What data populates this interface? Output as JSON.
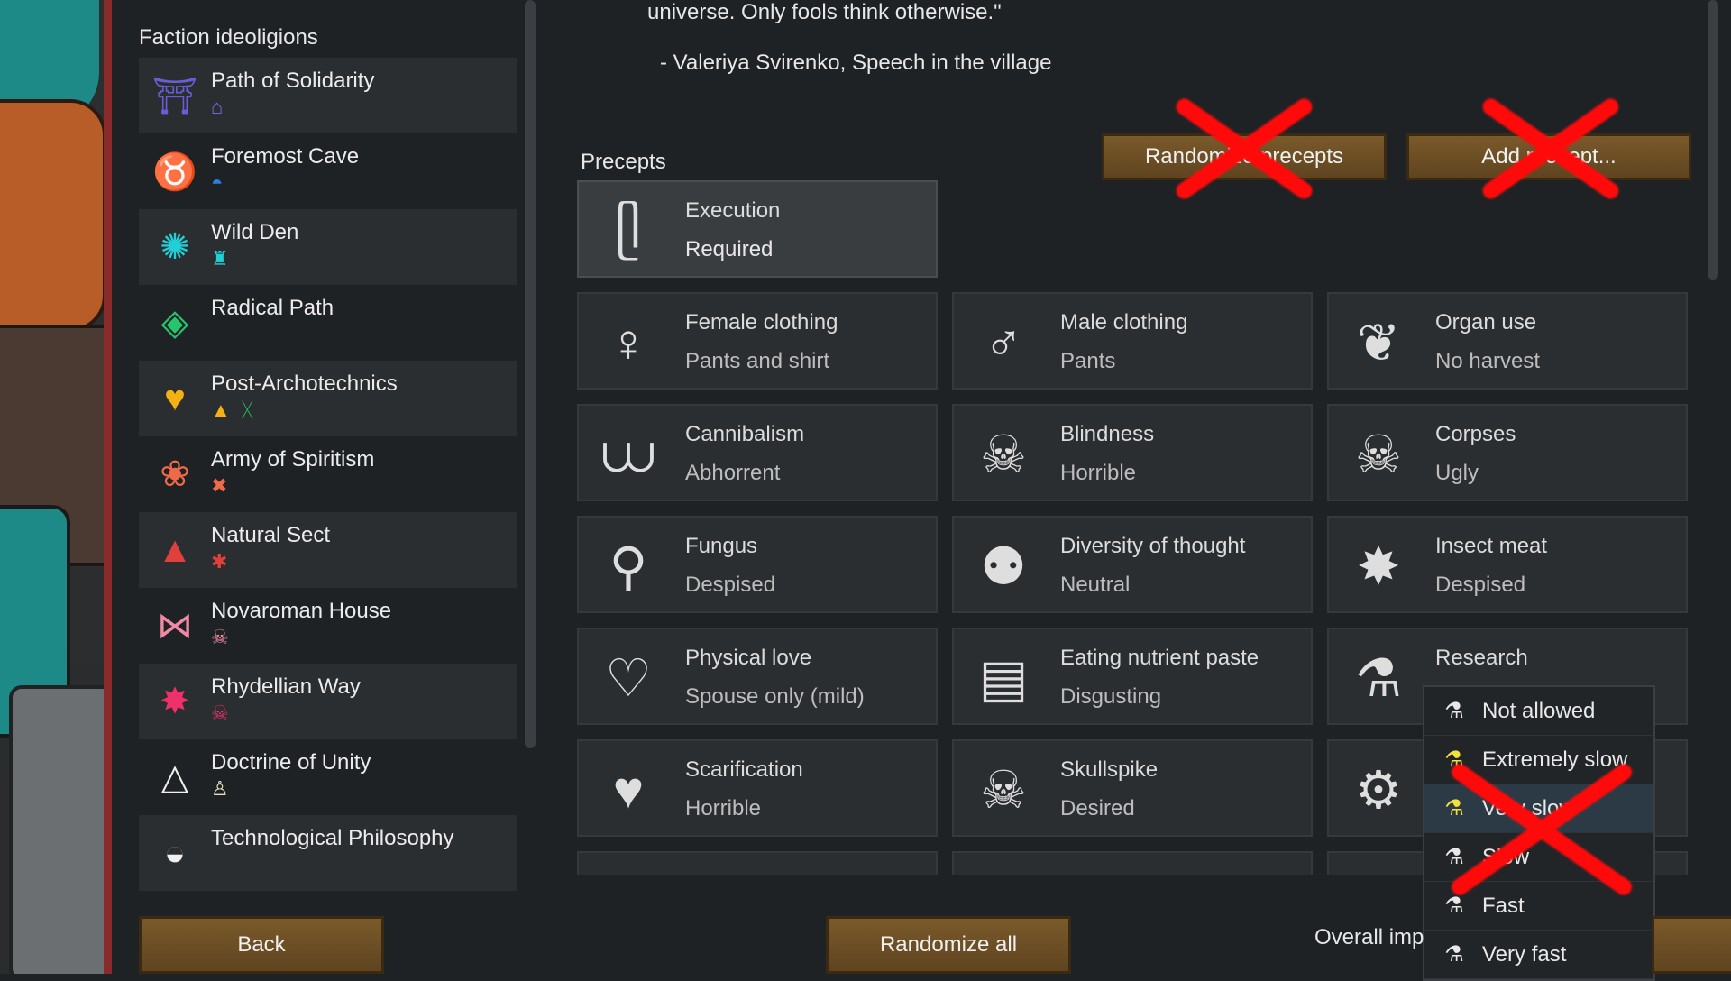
{
  "sidebar": {
    "title": "Faction ideoligions",
    "items": [
      {
        "name": "Path of Solidarity",
        "icon": "torii-icon",
        "icon_char": "⛩",
        "icon_color": "#6a5ed8",
        "minis": [
          {
            "name": "house-icon",
            "char": "⌂",
            "color": "#7b6cf0"
          }
        ]
      },
      {
        "name": "Foremost Cave",
        "icon": "horned-icon",
        "icon_char": "♉",
        "icon_color": "#2a7fe0",
        "minis": [
          {
            "name": "dome-icon",
            "char": "◓",
            "color": "#2a7fe0"
          }
        ]
      },
      {
        "name": "Wild Den",
        "icon": "spiral-icon",
        "icon_char": "✺",
        "icon_color": "#20d0d6",
        "minis": [
          {
            "name": "tower-icon",
            "char": "♜",
            "color": "#20d0d6"
          }
        ]
      },
      {
        "name": "Radical Path",
        "icon": "diamond-icon",
        "icon_char": "◈",
        "icon_color": "#26c46d",
        "minis": []
      },
      {
        "name": "Post-Archotechnics",
        "icon": "heart-split-icon",
        "icon_char": "♥",
        "icon_color": "#f5b014",
        "minis": [
          {
            "name": "warning-icon",
            "char": "▲",
            "color": "#f5b014"
          },
          {
            "name": "tongs-icon",
            "char": "ᚷ",
            "color": "#26c46d"
          }
        ]
      },
      {
        "name": "Army of Spiritism",
        "icon": "lotus-icon",
        "icon_char": "❀",
        "icon_color": "#f06a4a",
        "minis": [
          {
            "name": "crossed-icon",
            "char": "✖",
            "color": "#f06a4a"
          }
        ]
      },
      {
        "name": "Natural Sect",
        "icon": "triangle-icon",
        "icon_char": "▲",
        "icon_color": "#e0403c",
        "minis": [
          {
            "name": "bug-icon",
            "char": "✱",
            "color": "#e0403c"
          }
        ]
      },
      {
        "name": "Novaroman House",
        "icon": "bow-icon",
        "icon_char": "⋈",
        "icon_color": "#f08aa4",
        "minis": [
          {
            "name": "skull-mini-icon",
            "char": "☠",
            "color": "#f08aa4"
          }
        ]
      },
      {
        "name": "Rhydellian Way",
        "icon": "star-burst-icon",
        "icon_char": "✸",
        "icon_color": "#f0306a",
        "minis": [
          {
            "name": "skull-mini-icon",
            "char": "☠",
            "color": "#f0306a"
          }
        ]
      },
      {
        "name": "Doctrine of Unity",
        "icon": "pyramid-icon",
        "icon_char": "△",
        "icon_color": "#f0f0f0",
        "minis": [
          {
            "name": "pillar-icon",
            "char": "♙",
            "color": "#e8e0c0"
          }
        ]
      },
      {
        "name": "Technological Philosophy",
        "icon": "helmet-icon",
        "icon_char": "◒",
        "icon_color": "#f0f0f0",
        "minis": []
      }
    ]
  },
  "quote": {
    "line": "universe. Only fools think otherwise.\"",
    "author": "- Valeriya Svirenko, Speech in the village"
  },
  "precepts": {
    "title": "Precepts",
    "randomize_label": "Randomize precepts",
    "add_label": "Add precept...",
    "cards": [
      {
        "name": "Execution",
        "value": "Required",
        "icon": "noose-icon",
        "char": "ᥫ",
        "selected": true
      },
      {
        "name": "Female clothing",
        "value": "Pants and shirt",
        "icon": "hanger-female-icon",
        "char": "♀"
      },
      {
        "name": "Male clothing",
        "value": "Pants",
        "icon": "hanger-male-icon",
        "char": "♂"
      },
      {
        "name": "Organ use",
        "value": "No harvest",
        "icon": "organ-icon",
        "char": "❦"
      },
      {
        "name": "Cannibalism",
        "value": "Abhorrent",
        "icon": "teeth-icon",
        "char": "⩊"
      },
      {
        "name": "Blindness",
        "value": "Horrible",
        "icon": "skull-blind-icon",
        "char": "☠"
      },
      {
        "name": "Corpses",
        "value": "Ugly",
        "icon": "skeleton-icon",
        "char": "☠"
      },
      {
        "name": "Fungus",
        "value": "Despised",
        "icon": "mushroom-icon",
        "char": "⚲"
      },
      {
        "name": "Diversity of thought",
        "value": "Neutral",
        "icon": "people-icon",
        "char": "⚉"
      },
      {
        "name": "Insect meat",
        "value": "Despised",
        "icon": "insect-icon",
        "char": "✸"
      },
      {
        "name": "Physical love",
        "value": "Spouse only (mild)",
        "icon": "bed-heart-icon",
        "char": "♡"
      },
      {
        "name": "Eating nutrient paste",
        "value": "Disgusting",
        "icon": "paste-icon",
        "char": "▤"
      },
      {
        "name": "Research",
        "value": "",
        "icon": "flask-icon",
        "char": "⚗"
      },
      {
        "name": "Scarification",
        "value": "Horrible",
        "icon": "scarred-heart-icon",
        "char": "♥"
      },
      {
        "name": "Skullspike",
        "value": "Desired",
        "icon": "skullspike-icon",
        "char": "☠"
      },
      {
        "name": "",
        "value": "",
        "icon": "mech-icon",
        "char": "⚙"
      }
    ]
  },
  "dropdown": {
    "items": [
      {
        "label": "Not allowed",
        "flask_color": "#e8e8e8"
      },
      {
        "label": "Extremely slow",
        "flask_color": "#f0e040"
      },
      {
        "label": "Very slow",
        "flask_color": "#f0e040"
      },
      {
        "label": "Slow",
        "flask_color": "#e8e8e8"
      },
      {
        "label": "Fast",
        "flask_color": "#e8e8e8"
      },
      {
        "label": "Very fast",
        "flask_color": "#e8e8e8"
      }
    ]
  },
  "footer": {
    "back_label": "Back",
    "randomize_all_label": "Randomize all",
    "overall_label": "Overall imp"
  }
}
